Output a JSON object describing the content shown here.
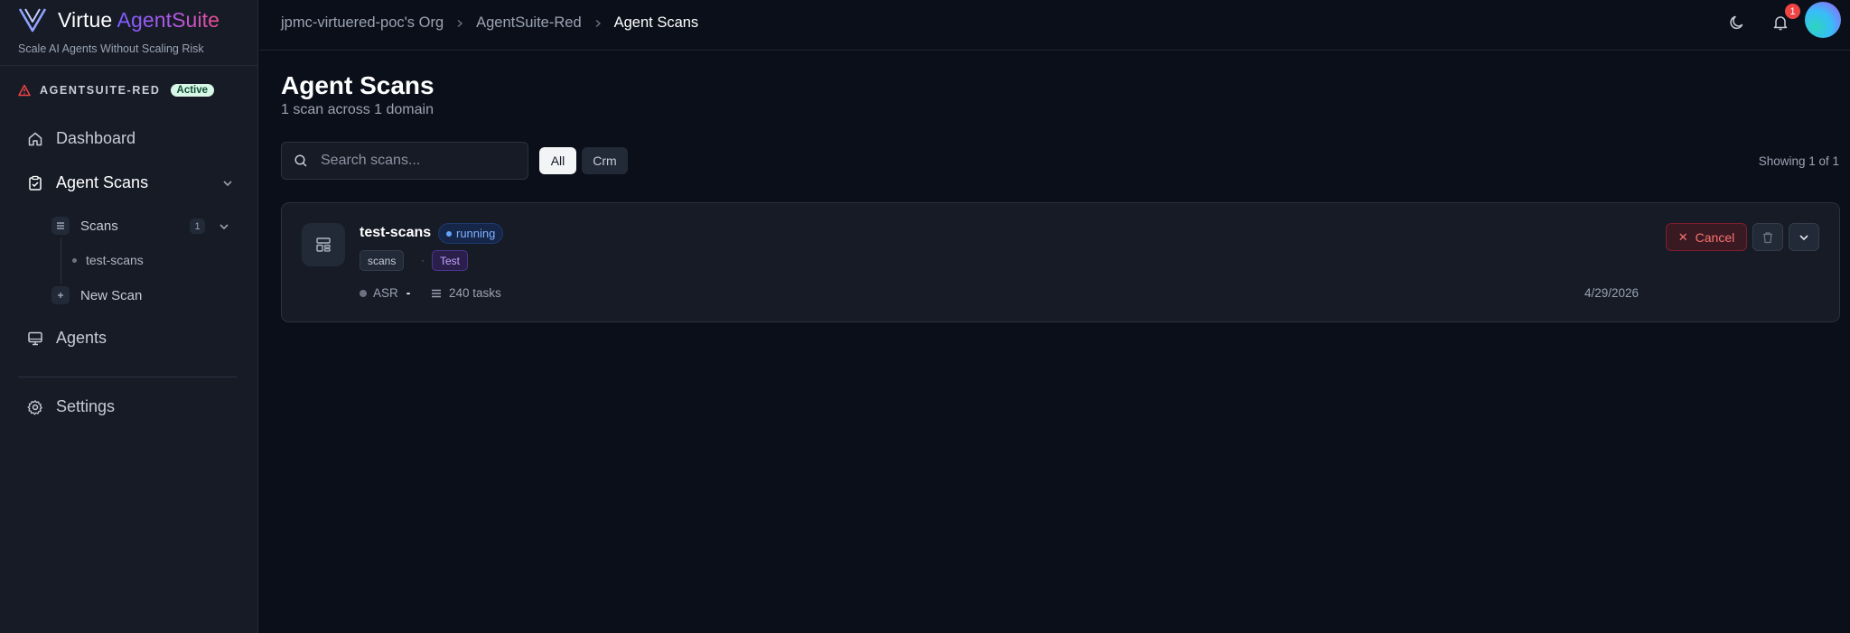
{
  "brand": {
    "name": "Virtue",
    "accent": "AgentSuite",
    "tagline": "Scale AI Agents Without Scaling Risk"
  },
  "workspace": {
    "name": "AGENTSUITE-RED",
    "status": "Active"
  },
  "nav": {
    "dashboard": "Dashboard",
    "agent_scans": "Agent Scans",
    "scans": "Scans",
    "scans_count": "1",
    "scan_leaf": "test-scans",
    "new_scan": "New Scan",
    "agents": "Agents",
    "settings": "Settings"
  },
  "breadcrumbs": [
    "jpmc-virtuered-poc's Org",
    "AgentSuite-Red",
    "Agent Scans"
  ],
  "notifications": {
    "count": "1"
  },
  "page": {
    "title": "Agent Scans",
    "subtitle": "1 scan across 1 domain"
  },
  "search": {
    "placeholder": "Search scans..."
  },
  "filters": [
    "All",
    "Crm"
  ],
  "showing": "Showing 1 of 1",
  "scan": {
    "name": "test-scans",
    "status": "running",
    "tags": [
      "scans",
      "Test"
    ],
    "tag_separator": "·",
    "asr_label": "ASR",
    "asr_value": "-",
    "tasks": "240 tasks",
    "date": "4/29/2026",
    "cancel_label": "Cancel"
  },
  "colors": {
    "accent_start": "#7c5cff",
    "accent_end": "#ec4d8e",
    "running": "#60a5fa",
    "danger": "#f87171",
    "active_badge": "#d9f7e6"
  }
}
